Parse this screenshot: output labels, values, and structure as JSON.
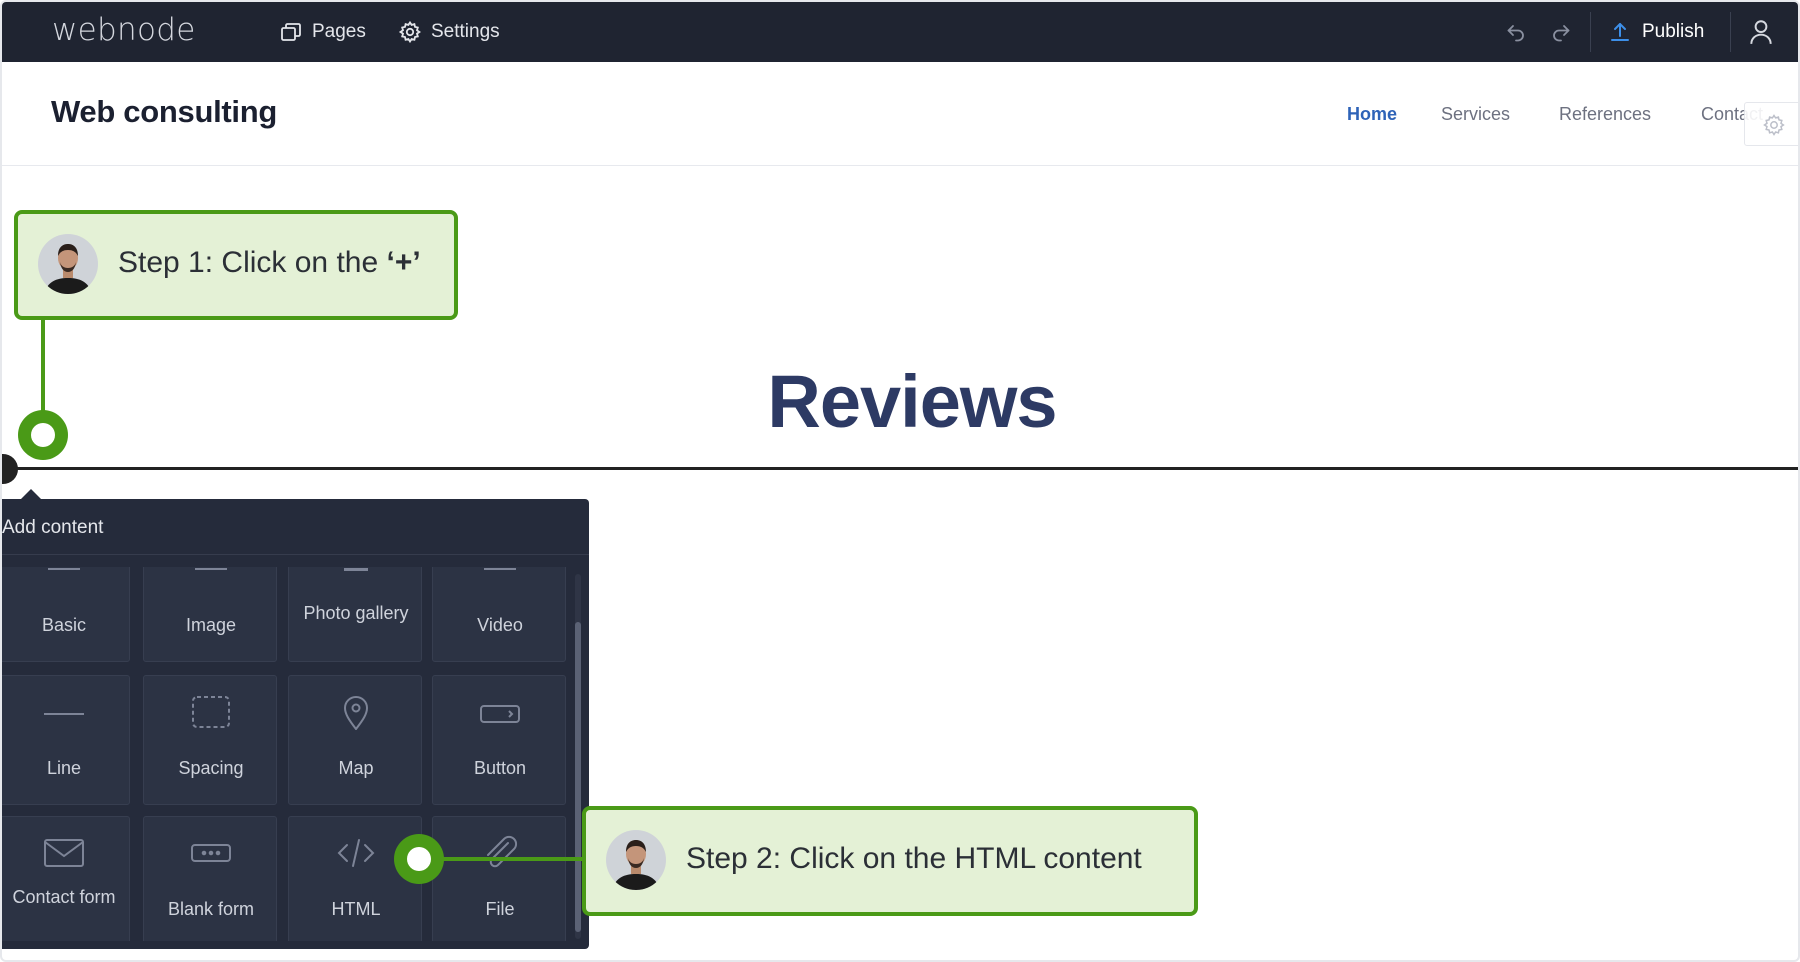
{
  "topbar": {
    "logo": "webnode",
    "pages_label": "Pages",
    "settings_label": "Settings",
    "publish_label": "Publish",
    "icons": [
      "pages-icon",
      "gear-icon",
      "undo-icon",
      "redo-icon",
      "upload-icon",
      "user-icon"
    ]
  },
  "site": {
    "title": "Web consulting",
    "nav": [
      {
        "label": "Home",
        "active": true
      },
      {
        "label": "Services",
        "active": false
      },
      {
        "label": "References",
        "active": false
      },
      {
        "label": "Contact",
        "active": false
      }
    ]
  },
  "main": {
    "heading": "Reviews"
  },
  "add_content": {
    "title": "Add content",
    "items": [
      {
        "label": "Basic",
        "icon": "text-icon"
      },
      {
        "label": "Image",
        "icon": "image-icon"
      },
      {
        "label": "Photo gallery",
        "icon": "gallery-icon"
      },
      {
        "label": "Video",
        "icon": "video-icon"
      },
      {
        "label": "Line",
        "icon": "line-icon"
      },
      {
        "label": "Spacing",
        "icon": "spacing-icon"
      },
      {
        "label": "Map",
        "icon": "map-pin-icon"
      },
      {
        "label": "Button",
        "icon": "button-icon"
      },
      {
        "label": "Contact form",
        "icon": "envelope-icon"
      },
      {
        "label": "Blank form",
        "icon": "form-field-icon"
      },
      {
        "label": "HTML",
        "icon": "code-icon"
      },
      {
        "label": "File",
        "icon": "paperclip-icon"
      }
    ]
  },
  "tutorial": {
    "step1_prefix": "Step 1: Click on the ",
    "step1_bold": "‘+’",
    "step2": "Step 2: Click on the HTML content"
  },
  "colors": {
    "topbar_bg": "#1f2431",
    "panel_bg": "#252b3b",
    "callout_bg": "#e4f1d6",
    "callout_border": "#4a9a17",
    "heading": "#2d3a64",
    "nav_active": "#2e63b8"
  }
}
